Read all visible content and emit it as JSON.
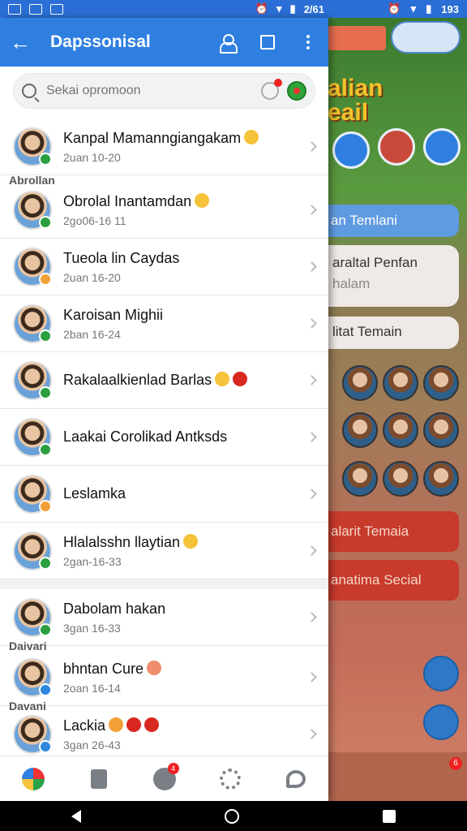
{
  "status_bar": {
    "time_left": "2/61",
    "time_right": "193"
  },
  "app_bar": {
    "title": "Dapssonisal"
  },
  "search": {
    "placeholder": "Sekai opromoon"
  },
  "section_labels": {
    "first": "Abrollan",
    "second": "Daivari",
    "third": "Davani"
  },
  "contacts": [
    {
      "name": "Kanpal Mamanngiangakam",
      "sub": "2uan 10-20"
    },
    {
      "name": "Obrolal Inantamdan",
      "sub": "2go06-16 11"
    },
    {
      "name": "Tueola lin Caydas",
      "sub": "2uan 16-20"
    },
    {
      "name": "Karoisan Mighii",
      "sub": "2ban 16-24"
    },
    {
      "name": "Rakalaalkienlad Barlas",
      "sub": ""
    },
    {
      "name": "Laakai Corolikad Antksds",
      "sub": ""
    },
    {
      "name": "Leslamka",
      "sub": ""
    },
    {
      "name": "Hlalalsshn llaytian",
      "sub": "2gan-16-33"
    },
    {
      "name": "Dabolam hakan",
      "sub": "3gan 16-33"
    },
    {
      "name": "bhntan  Cure",
      "sub": "2oan 16-14"
    },
    {
      "name": "Lackia",
      "sub": "3gan 26-43"
    }
  ],
  "bg_game": {
    "title_line1": "alian",
    "title_line2": "eail",
    "pill_blue": "an Temlani",
    "card_line1": "araltal Penfan",
    "card_line2": "halam",
    "toggle_label": "litat Temain",
    "red_btn_1": "alarit Temaia",
    "red_btn_2": "anatima Secial",
    "tab_badge": "6"
  },
  "tab_bar": {
    "check_badge": "4"
  }
}
